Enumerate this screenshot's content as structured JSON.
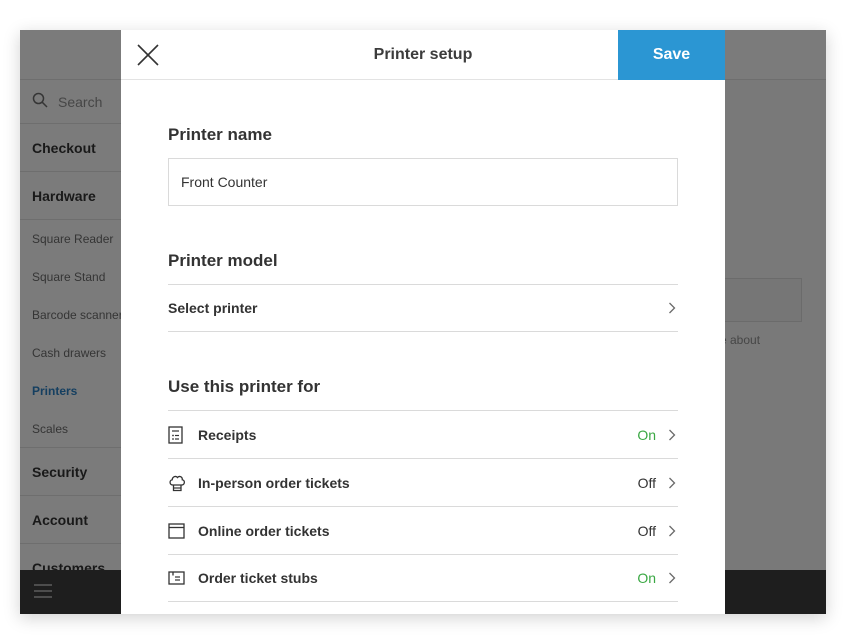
{
  "sidebar": {
    "search_placeholder": "Search",
    "items": [
      {
        "label": "Checkout",
        "kind": "major"
      },
      {
        "label": "Hardware",
        "kind": "major"
      },
      {
        "label": "Square Reader",
        "kind": "minor"
      },
      {
        "label": "Square Stand",
        "kind": "minor"
      },
      {
        "label": "Barcode scanners",
        "kind": "minor"
      },
      {
        "label": "Cash drawers",
        "kind": "minor"
      },
      {
        "label": "Printers",
        "kind": "minor",
        "active": true
      },
      {
        "label": "Scales",
        "kind": "minor"
      },
      {
        "label": "Security",
        "kind": "major"
      },
      {
        "label": "Account",
        "kind": "major"
      },
      {
        "label": "Customers",
        "kind": "major"
      }
    ]
  },
  "background": {
    "partial_text": "e about"
  },
  "modal": {
    "title": "Printer setup",
    "save_label": "Save",
    "printer_name_label": "Printer name",
    "printer_name_value": "Front Counter",
    "printer_model_label": "Printer model",
    "select_printer_label": "Select printer",
    "use_for_label": "Use this printer for",
    "uses": [
      {
        "icon": "receipt-icon",
        "label": "Receipts",
        "status": "On"
      },
      {
        "icon": "chef-hat-icon",
        "label": "In-person order tickets",
        "status": "Off"
      },
      {
        "icon": "browser-window-icon",
        "label": "Online order tickets",
        "status": "Off"
      },
      {
        "icon": "ticket-stub-icon",
        "label": "Order ticket stubs",
        "status": "On"
      }
    ]
  },
  "colors": {
    "accent": "#2b96d3",
    "status_on": "#3aa843",
    "active_nav": "#2b7ec1"
  }
}
